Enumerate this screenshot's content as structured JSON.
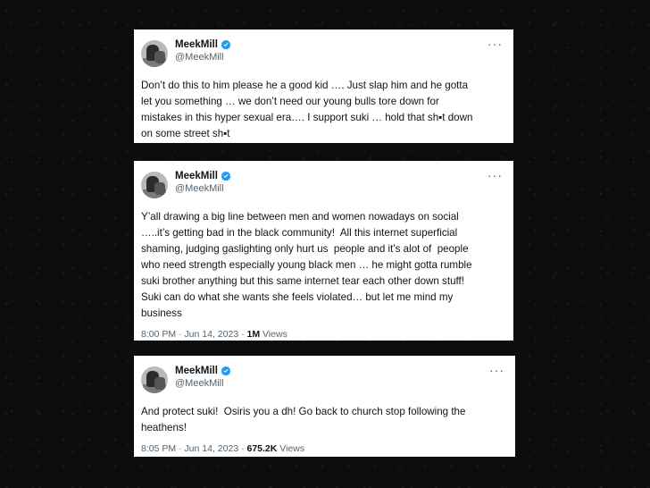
{
  "tweets": [
    {
      "name": "MeekMill",
      "handle": "@MeekMill",
      "more": "···",
      "text": "Don’t do this to him please he a good kid …. Just slap him and he gotta\nlet you something … we don’t need our young bulls tore down for\nmistakes in this hyper sexual era…. I support suki … hold that sh▪t down\non some street sh▪t",
      "time": "",
      "views_count": "",
      "views_label": ""
    },
    {
      "name": "MeekMill",
      "handle": "@MeekMill",
      "more": "···",
      "text": "Y’all drawing a big line between men and women nowadays on social\n…..it’s getting bad in the black community!  All this internet superficial\nshaming, judging gaslighting only hurt us  people and it’s alot of  people\nwho need strength especially young black men … he might gotta rumble\nsuki brother anything but this same internet tear each other down stuff!\nSuki can do what she wants she feels violated… but let me mind my\nbusiness",
      "time": "8:00 PM · Jun 14, 2023 · ",
      "views_count": "1M",
      "views_label": " Views"
    },
    {
      "name": "MeekMill",
      "handle": "@MeekMill",
      "more": "···",
      "text": "And protect suki!  Osiris you a dh! Go back to church stop following the\nheathens!",
      "time": "8:05 PM · Jun 14, 2023 · ",
      "views_count": "675.2K",
      "views_label": " Views"
    }
  ],
  "colors": {
    "verified": "#1d9bf0",
    "text": "#0f1419",
    "secondary": "#536471",
    "background": "#0c0c0c"
  },
  "icons": {
    "verified": "verified-badge-icon",
    "more": "more-options-icon"
  }
}
